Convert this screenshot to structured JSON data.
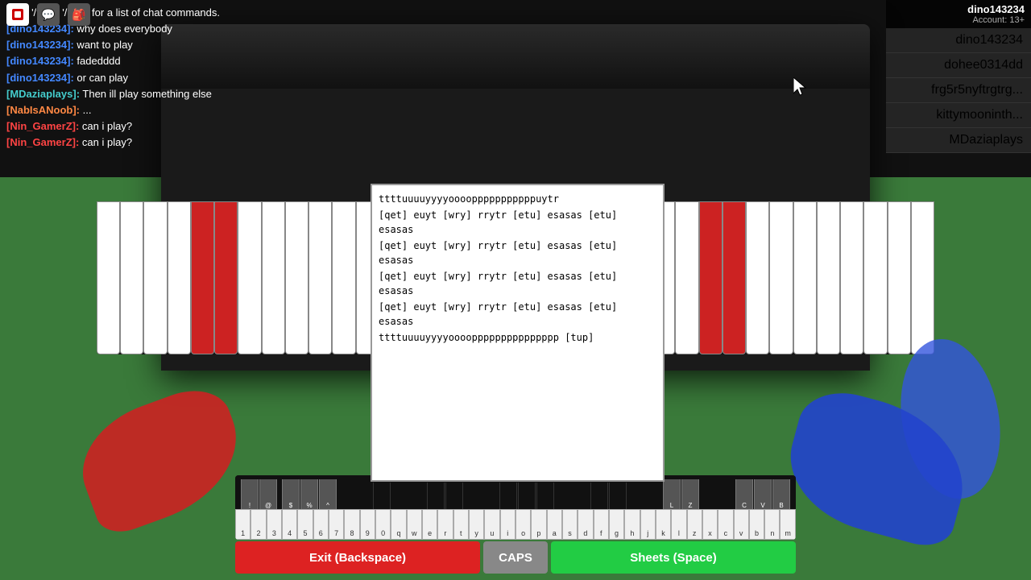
{
  "topbar": {
    "roblox_label": "R",
    "chat_icon": "💬",
    "bag_icon": "🎒"
  },
  "player_header": {
    "name": "dino143234",
    "account_label": "Account: 13+"
  },
  "player_list": [
    {
      "name": "dino143234"
    },
    {
      "name": "dohee0314dd"
    },
    {
      "name": "frg5r5nyftrgtrg..."
    },
    {
      "name": "kittymooninth..."
    },
    {
      "name": "MDaziaplays"
    }
  ],
  "chat": {
    "help_text": "Chat '/?!' or '/help' for a list of chat commands.",
    "messages": [
      {
        "user": "[dino143234]:",
        "text": " why does everybody",
        "user_color": "blue"
      },
      {
        "user": "[dino143234]:",
        "text": " want to play",
        "user_color": "blue"
      },
      {
        "user": "[dino143234]:",
        "text": " fadedddd",
        "user_color": "blue"
      },
      {
        "user": "[dino143234]:",
        "text": " or can play",
        "user_color": "blue"
      },
      {
        "user": "[MDaziaplays]:",
        "text": " Then ill play something else",
        "user_color": "cyan"
      },
      {
        "user": "[NabIsANoob]:",
        "text": " ...",
        "user_color": "orange"
      },
      {
        "user": "[Nin_GamerZ]:",
        "text": " can i play?",
        "user_color": "red"
      },
      {
        "user": "[Nin_GamerZ]:",
        "text": " can i play?",
        "user_color": "red"
      }
    ]
  },
  "sheet": {
    "lines": [
      "ttttuuuuyyyyoooopppppppppppuytr",
      "[qet] euyt [wry] rrytr [etu] esasas [etu] esasas",
      "[qet] euyt [wry] rrytr [etu] esasas [etu] esasas",
      "[qet] euyt [wry] rrytr [etu] esasas [etu] esasas",
      "[qet] euyt [wry] rrytr [etu] esasas [etu] esasas",
      "ttttuuuuyyyyooooppppppppppppppp [tup]"
    ]
  },
  "keyboard": {
    "white_keys": [
      "1",
      "2",
      "3",
      "4",
      "5",
      "6",
      "7",
      "8",
      "9",
      "0",
      "q",
      "w",
      "e",
      "r",
      "t",
      "y",
      "u",
      "i",
      "o",
      "p",
      "a",
      "s",
      "d",
      "f",
      "g",
      "h",
      "j",
      "k",
      "l",
      "z",
      "x",
      "c",
      "v",
      "b",
      "n",
      "m"
    ],
    "special_labels": [
      "!",
      "@",
      "$",
      "%",
      "^",
      "L",
      "Z",
      "C",
      "V",
      "B"
    ]
  },
  "buttons": {
    "exit_label": "Exit (Backspace)",
    "caps_label": "CAPS",
    "sheets_label": "Sheets (Space)"
  }
}
